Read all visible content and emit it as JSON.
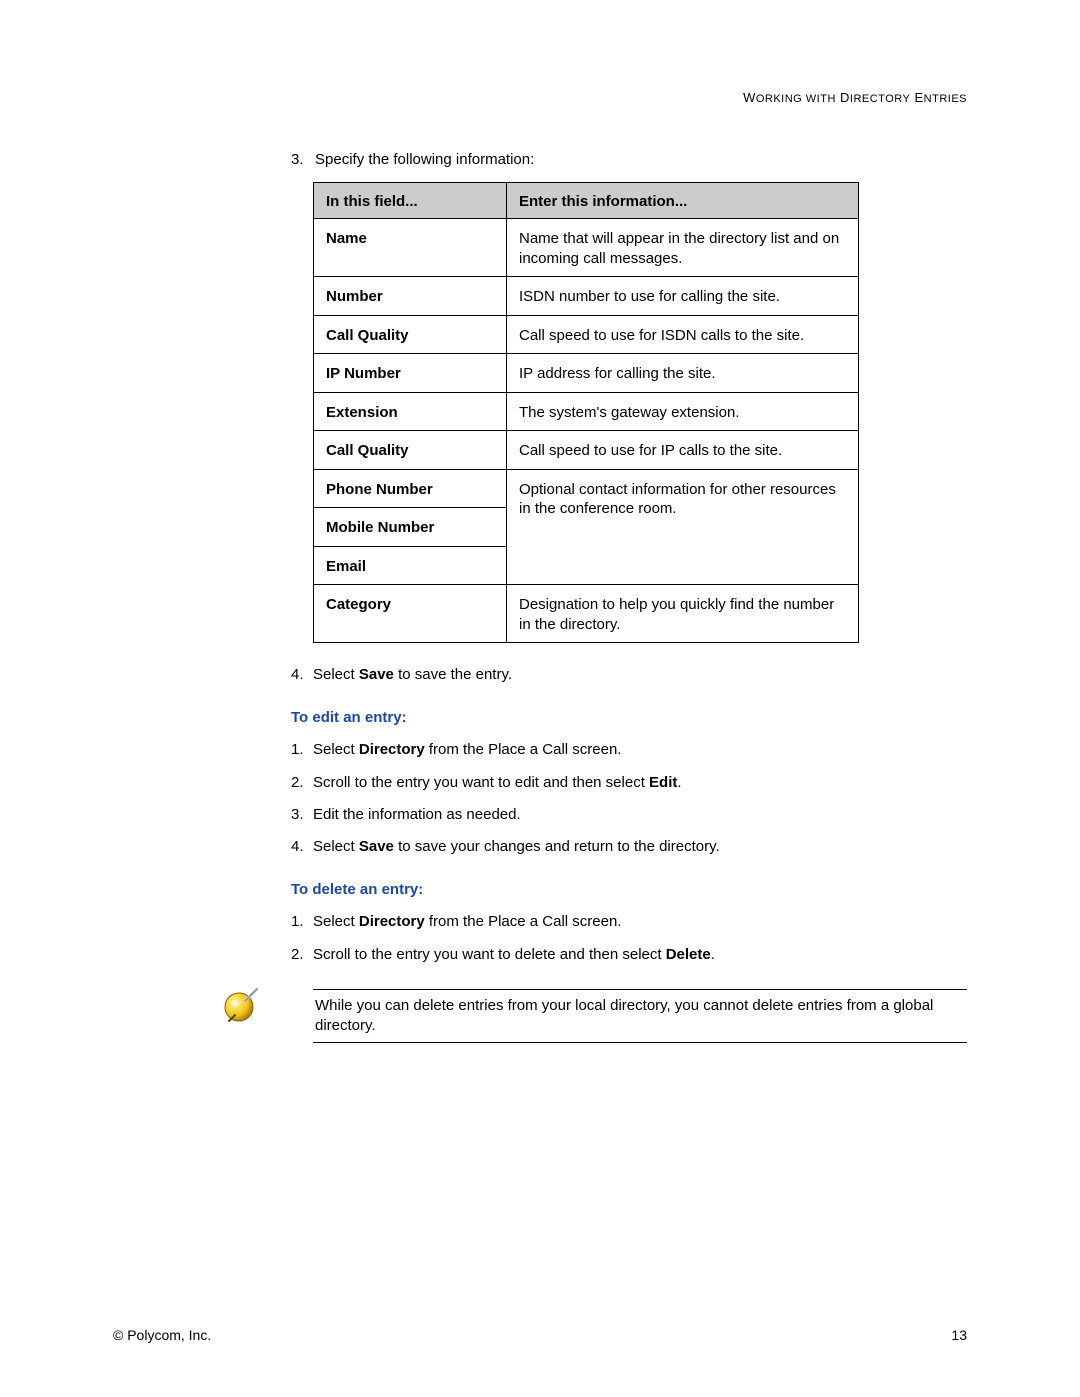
{
  "header": {
    "section_title": "WORKING WITH DIRECTORY ENTRIES"
  },
  "intro": {
    "step3_num": "3.",
    "step3_text": "Specify the following information:"
  },
  "table": {
    "th_field": "In this field...",
    "th_info": "Enter this information...",
    "rows": [
      {
        "field": "Name",
        "info": "Name that will appear in the directory list and on incoming call messages."
      },
      {
        "field": "Number",
        "info": "ISDN number to use for calling the site."
      },
      {
        "field": "Call Quality",
        "info": "Call speed to use for ISDN calls to the site."
      },
      {
        "field": "IP Number",
        "info": "IP address for calling the site."
      },
      {
        "field": "Extension",
        "info": "The system's gateway extension."
      },
      {
        "field": "Call Quality",
        "info": "Call speed to use for IP calls to the site."
      },
      {
        "field": "Phone Number",
        "info": "Optional contact information for other resources in the conference room."
      },
      {
        "field": "Mobile Number",
        "info": ""
      },
      {
        "field": "Email",
        "info": ""
      },
      {
        "field": "Category",
        "info": "Designation to help you quickly find the number in the directory."
      }
    ]
  },
  "after_table": {
    "step4_num": "4.",
    "step4_pre": "Select ",
    "step4_bold": "Save",
    "step4_post": " to save the entry."
  },
  "edit": {
    "heading": "To edit an entry:",
    "items": [
      {
        "n": "1.",
        "pre": "Select ",
        "bold": "Directory",
        "post": " from the Place a Call screen."
      },
      {
        "n": "2.",
        "pre": "Scroll to the entry you want to edit and then select ",
        "bold": "Edit",
        "post": "."
      },
      {
        "n": "3.",
        "pre": "Edit the information as needed.",
        "bold": "",
        "post": ""
      },
      {
        "n": "4.",
        "pre": "Select ",
        "bold": "Save",
        "post": " to save your changes and return to the directory."
      }
    ]
  },
  "delete": {
    "heading": "To delete an entry:",
    "items": [
      {
        "n": "1.",
        "pre": "Select ",
        "bold": "Directory",
        "post": " from the Place a Call screen."
      },
      {
        "n": "2.",
        "pre": "Scroll to the entry you want to delete and then select ",
        "bold": "Delete",
        "post": "."
      }
    ]
  },
  "note": {
    "text": "While you can delete entries from your local directory, you cannot delete entries from a global directory."
  },
  "footer": {
    "copyright": "© Polycom, Inc.",
    "page_number": "13"
  }
}
